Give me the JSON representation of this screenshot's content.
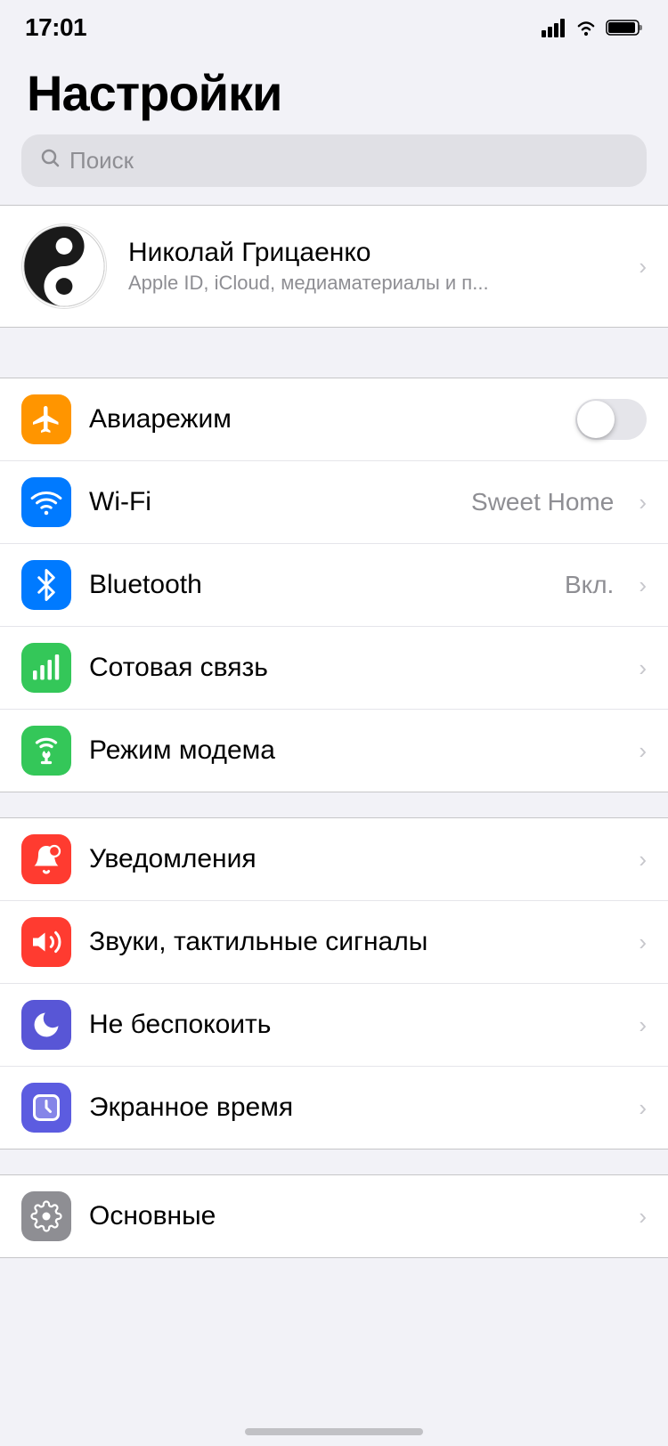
{
  "statusBar": {
    "time": "17:01",
    "locationArrow": "›"
  },
  "pageTitle": "Настройки",
  "search": {
    "placeholder": "Поиск"
  },
  "profile": {
    "name": "Николай Грицаенко",
    "subtitle": "Apple ID, iCloud, медиаматериалы и п..."
  },
  "section1": [
    {
      "id": "airplane",
      "label": "Авиарежим",
      "icon": "airplane",
      "iconColor": "icon-orange",
      "type": "toggle",
      "toggleOn": false
    },
    {
      "id": "wifi",
      "label": "Wi-Fi",
      "icon": "wifi",
      "iconColor": "icon-blue",
      "type": "value-chevron",
      "value": "Sweet Home"
    },
    {
      "id": "bluetooth",
      "label": "Bluetooth",
      "icon": "bluetooth",
      "iconColor": "icon-blue-dark",
      "type": "value-chevron",
      "value": "Вкл."
    },
    {
      "id": "cellular",
      "label": "Сотовая связь",
      "icon": "cellular",
      "iconColor": "icon-green",
      "type": "chevron"
    },
    {
      "id": "hotspot",
      "label": "Режим модема",
      "icon": "hotspot",
      "iconColor": "icon-green2",
      "type": "chevron"
    }
  ],
  "section2": [
    {
      "id": "notifications",
      "label": "Уведомления",
      "icon": "notifications",
      "iconColor": "icon-red",
      "type": "chevron"
    },
    {
      "id": "sounds",
      "label": "Звуки, тактильные сигналы",
      "icon": "sounds",
      "iconColor": "icon-red2",
      "type": "chevron"
    },
    {
      "id": "dnd",
      "label": "Не беспокоить",
      "icon": "moon",
      "iconColor": "icon-purple",
      "type": "chevron"
    },
    {
      "id": "screentime",
      "label": "Экранное время",
      "icon": "screentime",
      "iconColor": "icon-indigo",
      "type": "chevron"
    }
  ],
  "section3": [
    {
      "id": "general",
      "label": "Основные",
      "icon": "gear",
      "iconColor": "icon-gray",
      "type": "chevron"
    }
  ],
  "chevronChar": "›"
}
